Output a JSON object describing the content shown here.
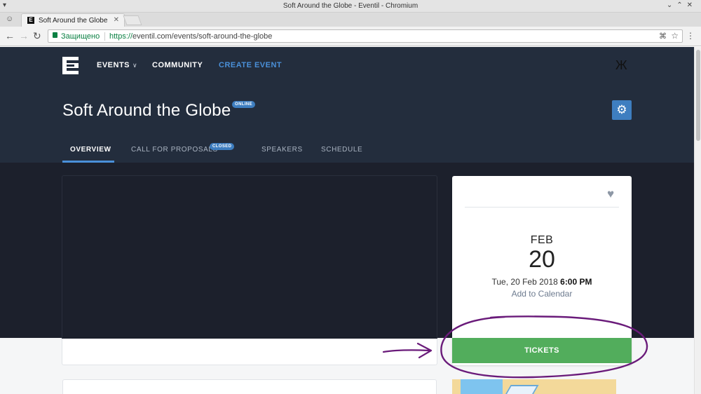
{
  "browser": {
    "window_title": "Soft Around the Globe - Eventil - Chromium",
    "tab_title": "Soft Around the Globe",
    "secure_label": "Защищено",
    "url_protocol": "https://",
    "url_rest": "eventil.com/events/soft-around-the-globe"
  },
  "header": {
    "nav_events": "EVENTS",
    "nav_community": "COMMUNITY",
    "nav_create": "CREATE EVENT",
    "event_title": "Soft Around the Globe",
    "online_badge": "ONLINE"
  },
  "subnav": {
    "overview": "OVERVIEW",
    "cfp": "CALL FOR PROPOSALS",
    "closed_badge": "CLOSED",
    "speakers": "SPEAKERS",
    "schedule": "SCHEDULE"
  },
  "date_card": {
    "month": "FEB",
    "day": "20",
    "date_text": "Tue, 20 Feb 2018",
    "time_text": "6:00 PM",
    "add_to_calendar": "Add to Calendar",
    "tickets_label": "TICKETS"
  },
  "colors": {
    "header_bg": "#232d3d",
    "accent": "#4a90d9",
    "tickets_green": "#52ad5c",
    "annotation_purple": "#6a1b7a"
  },
  "icons": [
    "back-icon",
    "forward-icon",
    "reload-icon",
    "lock-icon",
    "translate-icon",
    "star-icon",
    "menu-icon",
    "user-icon",
    "gear-icon",
    "heart-icon",
    "chevron-down-icon"
  ]
}
